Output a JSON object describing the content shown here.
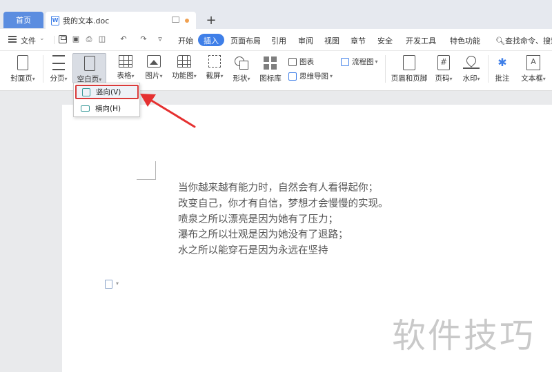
{
  "tabs": {
    "home": "首页",
    "document": "我的文本.doc",
    "add": "+"
  },
  "menu": {
    "file": "文件",
    "tabs": [
      "开始",
      "插入",
      "页面布局",
      "引用",
      "审阅",
      "视图",
      "章节",
      "安全",
      "开发工具",
      "特色功能"
    ],
    "active_tab": "插入",
    "search": "查找命令、搜索"
  },
  "ribbon": {
    "cover_page": "封面页",
    "page_break": "分页",
    "blank_page": "空白页",
    "table": "表格",
    "picture": "图片",
    "function_chart": "功能图",
    "screenshot": "截屏",
    "shape": "形状",
    "icon_library": "图标库",
    "chart": "图表",
    "mind_map": "思维导图",
    "flowchart": "流程图",
    "header_footer": "页眉和页脚",
    "page_number": "页码",
    "watermark": "水印",
    "annotation": "批注",
    "textbox": "文本框"
  },
  "dropdown": {
    "items": [
      "竖向(V)",
      "横向(H)"
    ],
    "highlighted": "竖向(V)"
  },
  "document": {
    "lines": [
      "当你越来越有能力时，自然会有人看得起你；",
      "改变自己，你才有自信，梦想才会慢慢的实现。",
      "喷泉之所以漂亮是因为她有了压力；",
      "瀑布之所以壮观是因为她没有了退路；",
      "水之所以能穿石是因为永远在坚持"
    ]
  },
  "watermark_text": "软件技巧",
  "colors": {
    "accent": "#3f7fe8",
    "highlight_border": "#d93a3a",
    "annotation_arrow": "#e53030"
  }
}
